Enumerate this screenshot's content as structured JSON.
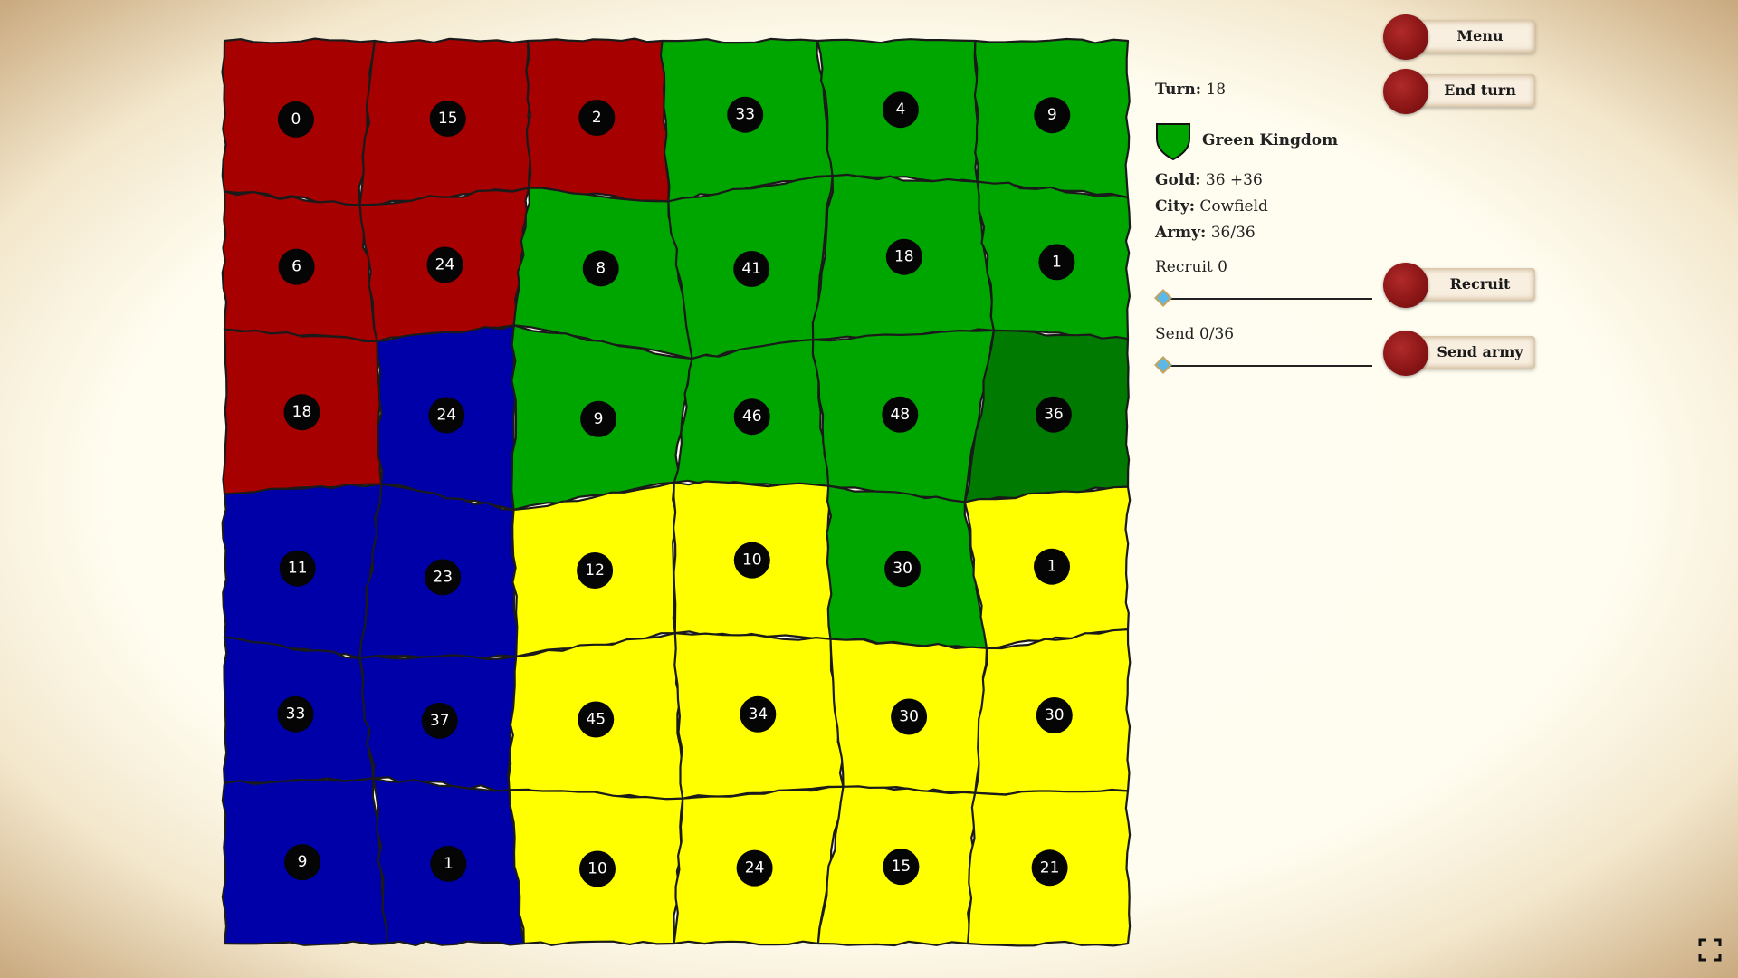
{
  "colors": {
    "red": "#a60000",
    "blue": "#0000a8",
    "green": "#00a600",
    "green_dark": "#007a00",
    "yellow": "#ffff00"
  },
  "map": {
    "regions": [
      {
        "color": "red",
        "army": "0"
      },
      {
        "color": "red",
        "army": "15"
      },
      {
        "color": "red",
        "army": "2"
      },
      {
        "color": "green",
        "army": "33"
      },
      {
        "color": "green",
        "army": "4"
      },
      {
        "color": "green",
        "army": "9"
      },
      {
        "color": "red",
        "army": "6"
      },
      {
        "color": "red",
        "army": "24"
      },
      {
        "color": "green",
        "army": "8"
      },
      {
        "color": "green",
        "army": "41"
      },
      {
        "color": "green",
        "army": "18"
      },
      {
        "color": "green",
        "army": "1"
      },
      {
        "color": "red",
        "army": "18"
      },
      {
        "color": "blue",
        "army": "24"
      },
      {
        "color": "green",
        "army": "9"
      },
      {
        "color": "green",
        "army": "46"
      },
      {
        "color": "green",
        "army": "48"
      },
      {
        "color": "green_dark",
        "army": "36"
      },
      {
        "color": "blue",
        "army": "11"
      },
      {
        "color": "blue",
        "army": "23"
      },
      {
        "color": "yellow",
        "army": "12"
      },
      {
        "color": "yellow",
        "army": "10"
      },
      {
        "color": "green",
        "army": "30"
      },
      {
        "color": "yellow",
        "army": "1"
      },
      {
        "color": "blue",
        "army": "33"
      },
      {
        "color": "blue",
        "army": "37"
      },
      {
        "color": "yellow",
        "army": "45"
      },
      {
        "color": "yellow",
        "army": "34"
      },
      {
        "color": "yellow",
        "army": "30"
      },
      {
        "color": "yellow",
        "army": "30"
      },
      {
        "color": "blue",
        "army": "9"
      },
      {
        "color": "blue",
        "army": "1"
      },
      {
        "color": "yellow",
        "army": "10"
      },
      {
        "color": "yellow",
        "army": "24"
      },
      {
        "color": "yellow",
        "army": "15"
      },
      {
        "color": "yellow",
        "army": "21"
      }
    ]
  },
  "status": {
    "turn_label": "Turn:",
    "turn_value": "18",
    "kingdom_name": "Green Kingdom",
    "kingdom_shield_color": "#00a600",
    "gold_label": "Gold:",
    "gold_value": "36 +36",
    "city_label": "City:",
    "city_value": "Cowfield",
    "army_label": "Army:",
    "army_value": "36/36",
    "recruit_label": "Recruit 0",
    "send_label": "Send 0/36"
  },
  "buttons": {
    "menu": "Menu",
    "end_turn": "End turn",
    "recruit": "Recruit",
    "send_army": "Send army"
  },
  "icons": {
    "fullscreen": "fullscreen-icon",
    "shield": "shield-icon",
    "seal": "wax-seal-icon"
  }
}
